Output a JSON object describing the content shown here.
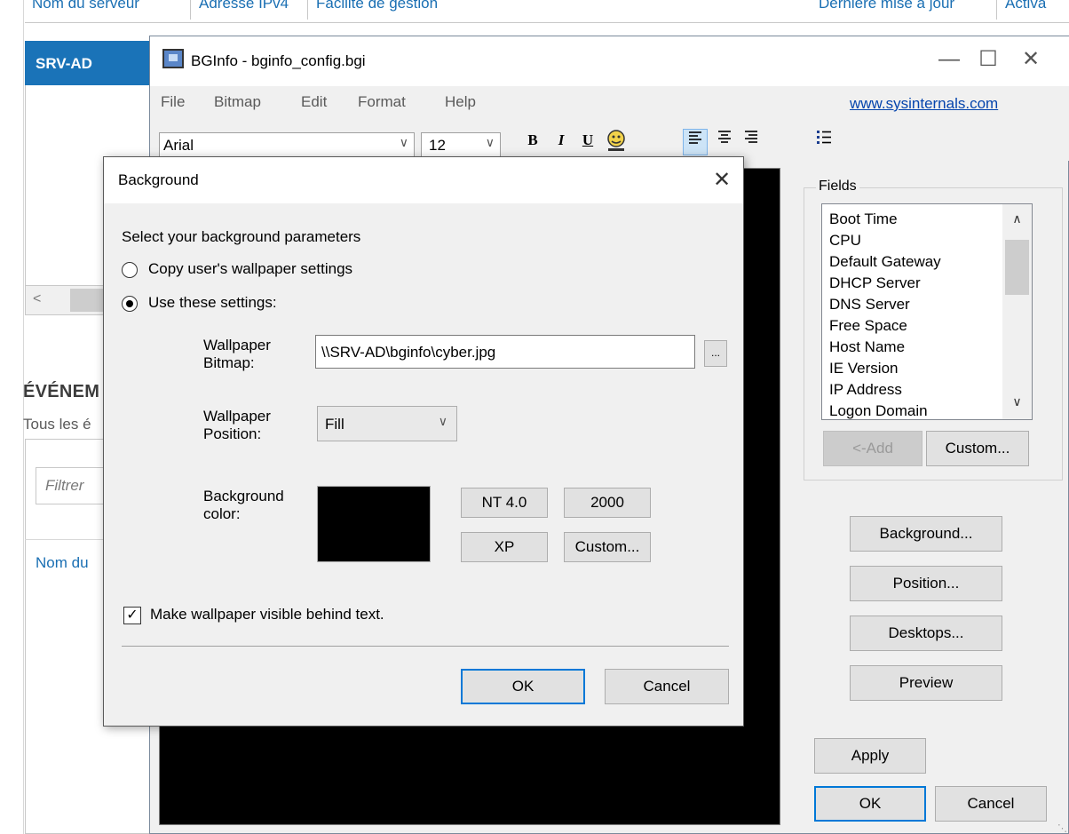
{
  "server_manager": {
    "columns": [
      "Nom du serveur",
      "Adresse IPv4",
      "Facilité de gestion",
      "Dernière mise à jour",
      "Activa"
    ],
    "selected_server": "SRV-AD",
    "events_title": "ÉVÉNEM",
    "events_subtitle": "Tous les é",
    "filter_placeholder": "Filtrer",
    "column_name": "Nom du",
    "right_edge_letter": "a"
  },
  "bginfo": {
    "title": "BGInfo - bginfo_config.bgi",
    "menu": [
      "File",
      "Bitmap",
      "Edit",
      "Format",
      "Help"
    ],
    "link": "www.sysinternals.com",
    "font_name": "Arial",
    "font_size": "12",
    "toolbar": {
      "bold": "B",
      "italic": "I",
      "underline": "U"
    },
    "fields_label": "Fields",
    "fields": [
      "Boot Time",
      "CPU",
      "Default Gateway",
      "DHCP Server",
      "DNS Server",
      "Free Space",
      "Host Name",
      "IE Version",
      "IP Address",
      "Logon Domain"
    ],
    "add_button": "<-Add",
    "custom_button": "Custom...",
    "background_button": "Background...",
    "position_button": "Position...",
    "desktops_button": "Desktops...",
    "preview_button": "Preview",
    "apply_button": "Apply",
    "ok_button": "OK",
    "cancel_button": "Cancel"
  },
  "dialog": {
    "title": "Background",
    "prompt": "Select your background parameters",
    "radio_copy": "Copy user's wallpaper settings",
    "radio_use": "Use these settings:",
    "selected_option": "use",
    "wallpaper_bitmap_label": "Wallpaper Bitmap:",
    "wallpaper_bitmap_value": "\\\\SRV-AD\\bginfo\\cyber.jpg",
    "browse_button": "...",
    "wallpaper_position_label": "Wallpaper Position:",
    "wallpaper_position_value": "Fill",
    "background_color_label": "Background color:",
    "background_color": "#000000",
    "preset_nt4": "NT 4.0",
    "preset_2000": "2000",
    "preset_xp": "XP",
    "preset_custom": "Custom...",
    "checkbox_label": "Make wallpaper visible behind text.",
    "checkbox_checked": true,
    "ok_button": "OK",
    "cancel_button": "Cancel"
  },
  "colors": {
    "accent": "#0078d7",
    "selection_blue": "#1a73b8",
    "link_blue": "#0645ad"
  }
}
